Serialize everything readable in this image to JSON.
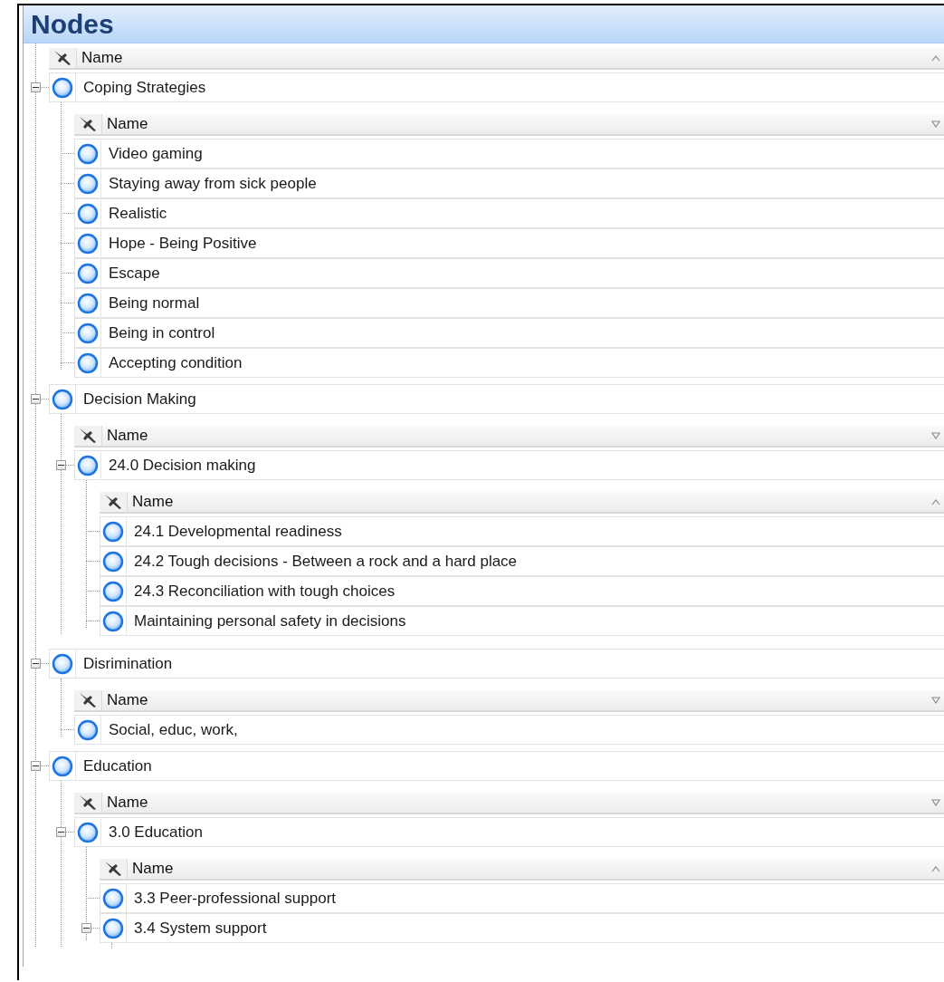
{
  "title": "Nodes",
  "grid": {
    "header": {
      "label": "Name",
      "ascending": true
    },
    "rows": [
      {
        "name": "Coping Strategies",
        "expanded": true,
        "children": {
          "header": {
            "label": "Name",
            "ascending": false
          },
          "rows": [
            {
              "name": "Video gaming"
            },
            {
              "name": "Staying away from sick people"
            },
            {
              "name": "Realistic"
            },
            {
              "name": "Hope - Being Positive"
            },
            {
              "name": "Escape"
            },
            {
              "name": "Being normal"
            },
            {
              "name": "Being in control"
            },
            {
              "name": "Accepting condition"
            }
          ]
        }
      },
      {
        "name": "Decision Making",
        "expanded": true,
        "children": {
          "header": {
            "label": "Name",
            "ascending": false
          },
          "rows": [
            {
              "name": "24.0 Decision making",
              "expanded": true,
              "children": {
                "header": {
                  "label": "Name",
                  "ascending": true
                },
                "rows": [
                  {
                    "name": "24.1 Developmental readiness"
                  },
                  {
                    "name": "24.2 Tough decisions - Between a rock and a hard place"
                  },
                  {
                    "name": "24.3 Reconciliation with tough choices"
                  },
                  {
                    "name": "Maintaining personal safety in decisions"
                  }
                ]
              }
            }
          ]
        }
      },
      {
        "name": "Disrimination",
        "expanded": true,
        "children": {
          "header": {
            "label": "Name",
            "ascending": false
          },
          "rows": [
            {
              "name": "Social, educ, work,"
            }
          ]
        }
      },
      {
        "name": "Education",
        "expanded": true,
        "children": {
          "header": {
            "label": "Name",
            "ascending": false
          },
          "rows": [
            {
              "name": "3.0 Education",
              "expanded": true,
              "children": {
                "header": {
                  "label": "Name",
                  "ascending": true
                },
                "rows": [
                  {
                    "name": "3.3 Peer-professional support"
                  },
                  {
                    "name": "3.4 System support",
                    "expanded": true
                  }
                ]
              }
            }
          ]
        }
      }
    ]
  }
}
